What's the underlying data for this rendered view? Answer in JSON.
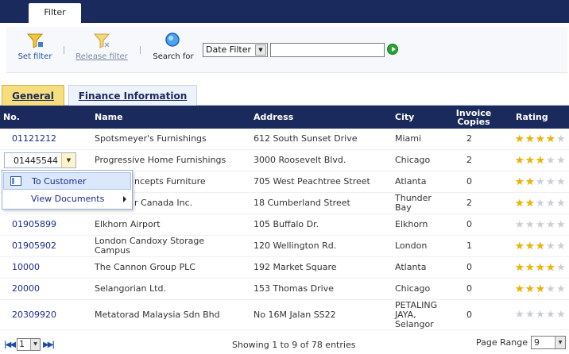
{
  "top_tab": {
    "label": "Filter"
  },
  "toolbar": {
    "set_filter": "Set filter",
    "release_filter": "Release filter",
    "search_for": "Search for",
    "date_filter_value": "Date Filter",
    "filter_input_value": ""
  },
  "tabs": [
    {
      "label": "General",
      "active": true
    },
    {
      "label": "Finance Information",
      "active": false
    }
  ],
  "columns": {
    "no": "No.",
    "name": "Name",
    "address": "Address",
    "city": "City",
    "invoice_copies": "Invoice Copies",
    "rating": "Rating"
  },
  "rows": [
    {
      "no": "01121212",
      "name": "Spotsmeyer's Furnishings",
      "address": "612 South Sunset Drive",
      "city": "Miami",
      "invoice_copies": "2",
      "rating": 4
    },
    {
      "no": "01445544",
      "name": "Progressive Home Furnishings",
      "address": "3000 Roosevelt Blvd.",
      "city": "Chicago",
      "invoice_copies": "2",
      "rating": 3
    },
    {
      "no": "",
      "name": "ncepts Furniture",
      "address": "705 West Peachtree Street",
      "city": "Atlanta",
      "invoice_copies": "0",
      "rating": 2
    },
    {
      "no": "",
      "name": "r Canada Inc.",
      "address": "18 Cumberland Street",
      "city": "Thunder Bay",
      "invoice_copies": "2",
      "rating": 2
    },
    {
      "no": "01905899",
      "name": "Elkhorn Airport",
      "address": "105 Buffalo Dr.",
      "city": "Elkhorn",
      "invoice_copies": "0",
      "rating": 0
    },
    {
      "no": "01905902",
      "name": "London Candoxy Storage Campus",
      "address": "120 Wellington Rd.",
      "city": "London",
      "invoice_copies": "1",
      "rating": 3
    },
    {
      "no": "10000",
      "name": "The Cannon Group PLC",
      "address": "192 Market Square",
      "city": "Atlanta",
      "invoice_copies": "0",
      "rating": 4
    },
    {
      "no": "20000",
      "name": "Selangorian Ltd.",
      "address": "153 Thomas Drive",
      "city": "Chicago",
      "invoice_copies": "0",
      "rating": 3
    },
    {
      "no": "20309920",
      "name": "Metatorad Malaysia Sdn Bhd",
      "address": "No 16M Jalan SS22",
      "city": "PETALING JAYA, Selangor",
      "invoice_copies": "0",
      "rating": 0
    }
  ],
  "rating_max": 5,
  "context_menu": {
    "to_customer": "To Customer",
    "view_documents": "View Documents"
  },
  "footer": {
    "page_value": "1",
    "showing": "Showing 1 to 9 of 78 entries",
    "page_range_label": "Page Range",
    "page_range_value": "9"
  },
  "colors": {
    "header_bg": "#1b2a5c",
    "active_tab": "#f6dd7e",
    "star_on": "#f0b400",
    "star_off": "#c9ced8"
  },
  "icons": [
    "funnel-icon",
    "funnel-release-icon",
    "magnifier-icon",
    "go-arrow-icon",
    "first-page-icon",
    "prev-page-icon",
    "next-page-icon",
    "last-page-icon",
    "star-icon",
    "customer-card-icon",
    "submenu-arrow-icon"
  ]
}
